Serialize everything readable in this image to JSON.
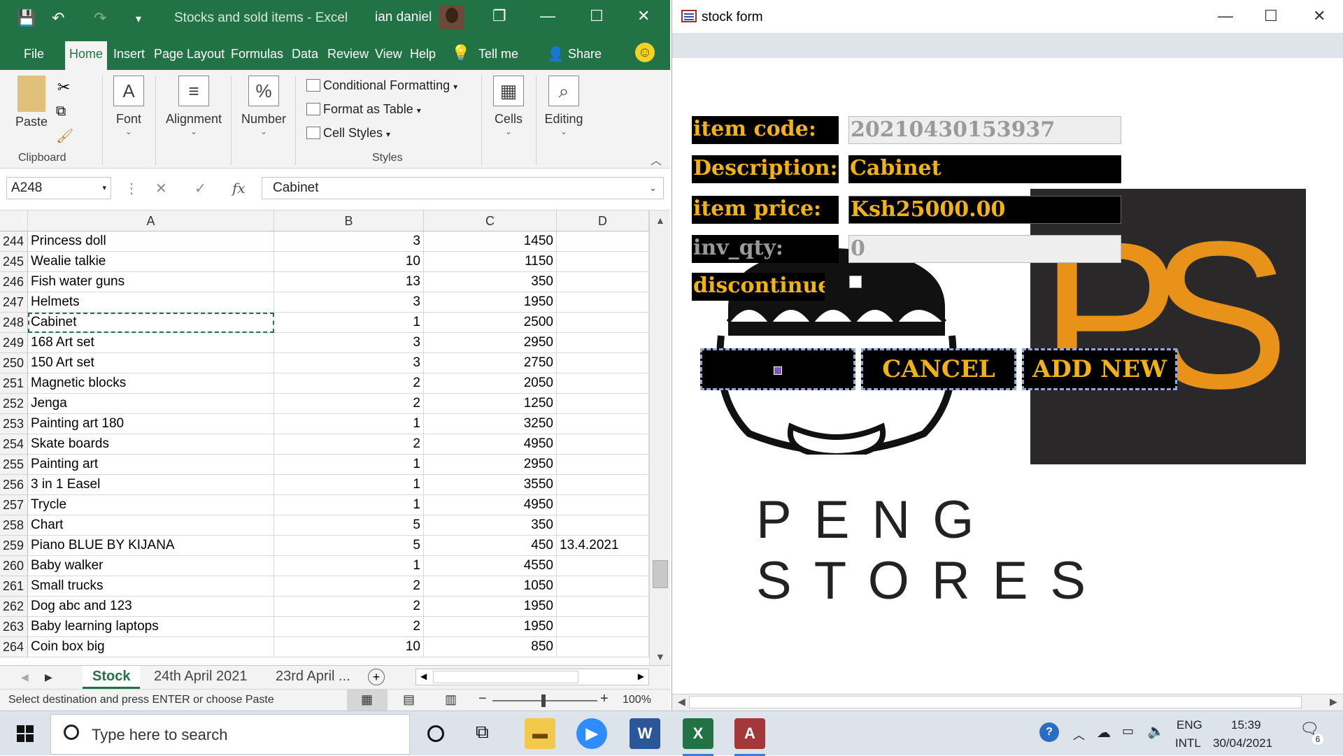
{
  "excel": {
    "window_title": "Stocks and sold items  -  Excel",
    "user": "ian daniel",
    "qa_save": "💾",
    "qa_undo": "↶",
    "qa_redo": "↷",
    "qa_customize": "▾",
    "win_restore": "❐",
    "win_max": "☐",
    "win_close": "✕",
    "tabs": [
      "File",
      "Home",
      "Insert",
      "Page Layout",
      "Formulas",
      "Data",
      "Review",
      "View",
      "Help"
    ],
    "tell_me": "Tell me",
    "share": "Share",
    "ribbon": {
      "paste": "Paste",
      "clipboard": "Clipboard",
      "font": "Font",
      "alignment": "Alignment",
      "number": "Number",
      "conditional_formatting": "Conditional Formatting",
      "format_as_table": "Format as Table",
      "cell_styles": "Cell Styles",
      "styles": "Styles",
      "cells": "Cells",
      "editing": "Editing"
    },
    "name_box": "A248",
    "formula_value": "Cabinet",
    "fx": "fx",
    "columns": [
      "A",
      "B",
      "C",
      "D"
    ],
    "rows": [
      {
        "n": "244",
        "a": "Princess doll",
        "b": "3",
        "c": "1450",
        "d": ""
      },
      {
        "n": "245",
        "a": "Wealie talkie",
        "b": "10",
        "c": "1150",
        "d": ""
      },
      {
        "n": "246",
        "a": "Fish water guns",
        "b": "13",
        "c": "350",
        "d": ""
      },
      {
        "n": "247",
        "a": "Helmets",
        "b": "3",
        "c": "1950",
        "d": ""
      },
      {
        "n": "248",
        "a": "Cabinet",
        "b": "1",
        "c": "2500",
        "d": ""
      },
      {
        "n": "249",
        "a": "168 Art set",
        "b": "3",
        "c": "2950",
        "d": ""
      },
      {
        "n": "250",
        "a": "150 Art set",
        "b": "3",
        "c": "2750",
        "d": ""
      },
      {
        "n": "251",
        "a": "Magnetic blocks",
        "b": "2",
        "c": "2050",
        "d": ""
      },
      {
        "n": "252",
        "a": "Jenga",
        "b": "2",
        "c": "1250",
        "d": ""
      },
      {
        "n": "253",
        "a": "Painting art 180",
        "b": "1",
        "c": "3250",
        "d": ""
      },
      {
        "n": "254",
        "a": "Skate boards",
        "b": "2",
        "c": "4950",
        "d": ""
      },
      {
        "n": "255",
        "a": "Painting art",
        "b": "1",
        "c": "2950",
        "d": ""
      },
      {
        "n": "256",
        "a": "3 in 1 Easel",
        "b": "1",
        "c": "3550",
        "d": ""
      },
      {
        "n": "257",
        "a": "Trycle",
        "b": "1",
        "c": "4950",
        "d": ""
      },
      {
        "n": "258",
        "a": "Chart",
        "b": "5",
        "c": "350",
        "d": ""
      },
      {
        "n": "259",
        "a": "Piano BLUE BY KIJANA",
        "b": "5",
        "c": "450",
        "d": "13.4.2021"
      },
      {
        "n": "260",
        "a": "Baby walker",
        "b": "1",
        "c": "4550",
        "d": ""
      },
      {
        "n": "261",
        "a": "Small trucks",
        "b": "2",
        "c": "1050",
        "d": ""
      },
      {
        "n": "262",
        "a": "Dog abc and 123",
        "b": "2",
        "c": "1950",
        "d": ""
      },
      {
        "n": "263",
        "a": "Baby learning laptops",
        "b": "2",
        "c": "1950",
        "d": ""
      },
      {
        "n": "264",
        "a": "Coin box big",
        "b": "10",
        "c": "850",
        "d": ""
      }
    ],
    "sheet_tabs": [
      "Stock",
      "24th April 2021",
      "23rd April ..."
    ],
    "status": "Select destination and press ENTER or choose Paste",
    "zoom": "100%"
  },
  "access": {
    "window_title": "stock form",
    "labels": {
      "item_code": "item code:",
      "description": "Description:",
      "item_price": "item price:",
      "inv_qty": "inv_qty:",
      "discontinue": "discontinue:"
    },
    "values": {
      "item_code": "20210430153937",
      "description": "Cabinet",
      "item_price": "Ksh25000.00",
      "inv_qty": "0"
    },
    "buttons": {
      "save": "",
      "cancel": "CANCEL",
      "add_new": "ADD NEW"
    },
    "logo_letters": {
      "p": "P",
      "s": "S"
    },
    "logo_text": "PENG STORES"
  },
  "taskbar": {
    "search_placeholder": "Type here to search",
    "lang": "ENG",
    "layout": "INTL",
    "time": "15:39",
    "date": "30/04/2021",
    "notifications": "6"
  },
  "colors": {
    "excel_green": "#217346",
    "form_gold": "#f2b312",
    "logo_orange": "#e8921a"
  }
}
